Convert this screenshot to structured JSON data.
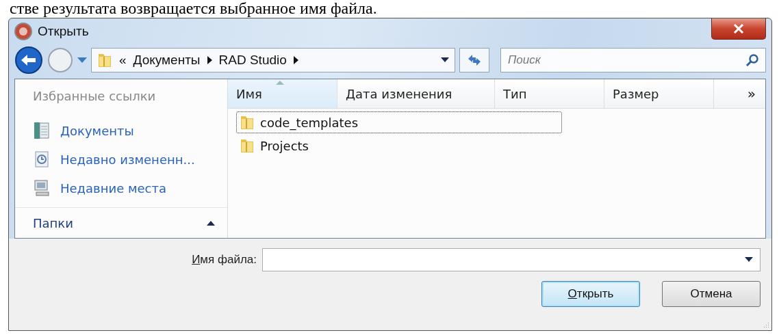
{
  "document_text": "стве результата возвращается выбранное имя файла.",
  "window": {
    "title": "Открыть"
  },
  "breadcrumb": {
    "overflow": "«",
    "items": [
      "Документы",
      "RAD Studio"
    ]
  },
  "search": {
    "placeholder": "Поиск"
  },
  "sidebar": {
    "heading": "Избранные ссылки",
    "items": [
      {
        "label": "Документы",
        "kind": "documents"
      },
      {
        "label": "Недавно измененн...",
        "kind": "recent"
      },
      {
        "label": "Недавние места",
        "kind": "places"
      }
    ],
    "folders": {
      "label": "Папки",
      "expanded": false
    }
  },
  "columns": [
    {
      "label": "Имя",
      "sorted": true
    },
    {
      "label": "Дата изменения",
      "sorted": false
    },
    {
      "label": "Тип",
      "sorted": false
    },
    {
      "label": "Размер",
      "sorted": false
    }
  ],
  "more_columns": "»",
  "files": [
    {
      "name": "code_templates",
      "focused": true
    },
    {
      "name": "Projects",
      "focused": false
    }
  ],
  "filename": {
    "label": "Имя файла:"
  },
  "buttons": [
    {
      "label": "Открыть",
      "default": true
    },
    {
      "label": "Отмена",
      "default": false
    }
  ]
}
